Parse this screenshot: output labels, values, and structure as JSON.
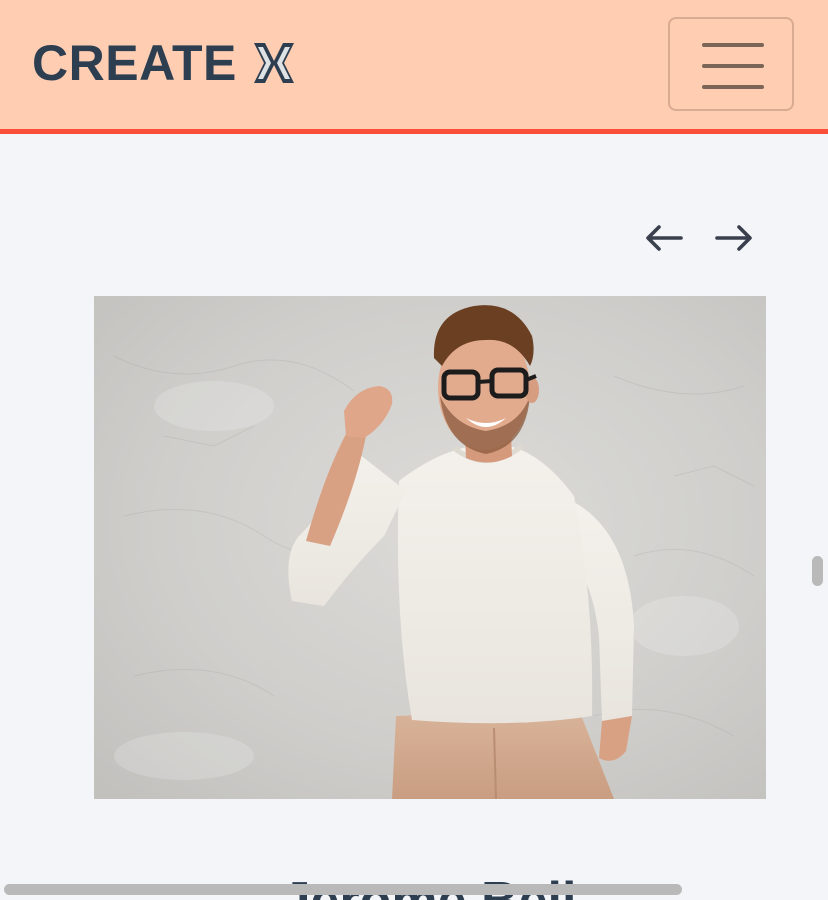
{
  "header": {
    "logo_text": "CREATE",
    "logo_mark_icon": "chevrons-inward-icon",
    "menu_icon": "hamburger-menu-icon",
    "background_color": "#fecdb2",
    "border_color": "#f94f3b"
  },
  "carousel": {
    "prev_icon": "arrow-left-icon",
    "next_icon": "arrow-right-icon",
    "current_person": {
      "name": "Jerome Bell"
    }
  },
  "colors": {
    "text": "#2c3e50",
    "page_background": "#f4f5f8"
  }
}
